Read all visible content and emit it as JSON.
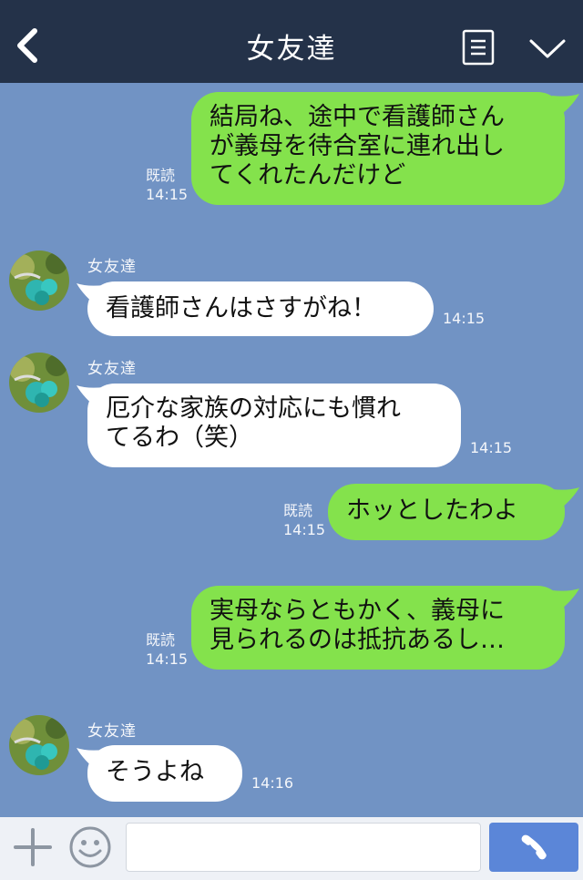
{
  "header": {
    "title": "女友達"
  },
  "messages": [
    {
      "from": "me",
      "lines": "結局ね、途中で看護師さん\nが義母を待合室に連れ出し\nてくれたんだけど",
      "read": "既読",
      "time": "14:15"
    },
    {
      "from": "them",
      "name": "女友達",
      "lines": "看護師さんはさすがね！",
      "time": "14:15"
    },
    {
      "from": "them",
      "name": "女友達",
      "lines": "厄介な家族の対応にも慣れ\nてるわ（笑）",
      "time": "14:15"
    },
    {
      "from": "me",
      "lines": "ホッとしたわよ",
      "read": "既読",
      "time": "14:15"
    },
    {
      "from": "me",
      "lines": "実母ならともかく、義母に\n見られるのは抵抗あるし…",
      "read": "既読",
      "time": "14:15"
    },
    {
      "from": "them",
      "name": "女友達",
      "lines": "そうよね",
      "time": "14:16"
    }
  ],
  "footer": {
    "input_placeholder": ""
  },
  "colors": {
    "header": "#243249",
    "background": "#7193c4",
    "my_bubble": "#84e24c",
    "their_bubble": "#ffffff",
    "call_button": "#5b86d8"
  }
}
